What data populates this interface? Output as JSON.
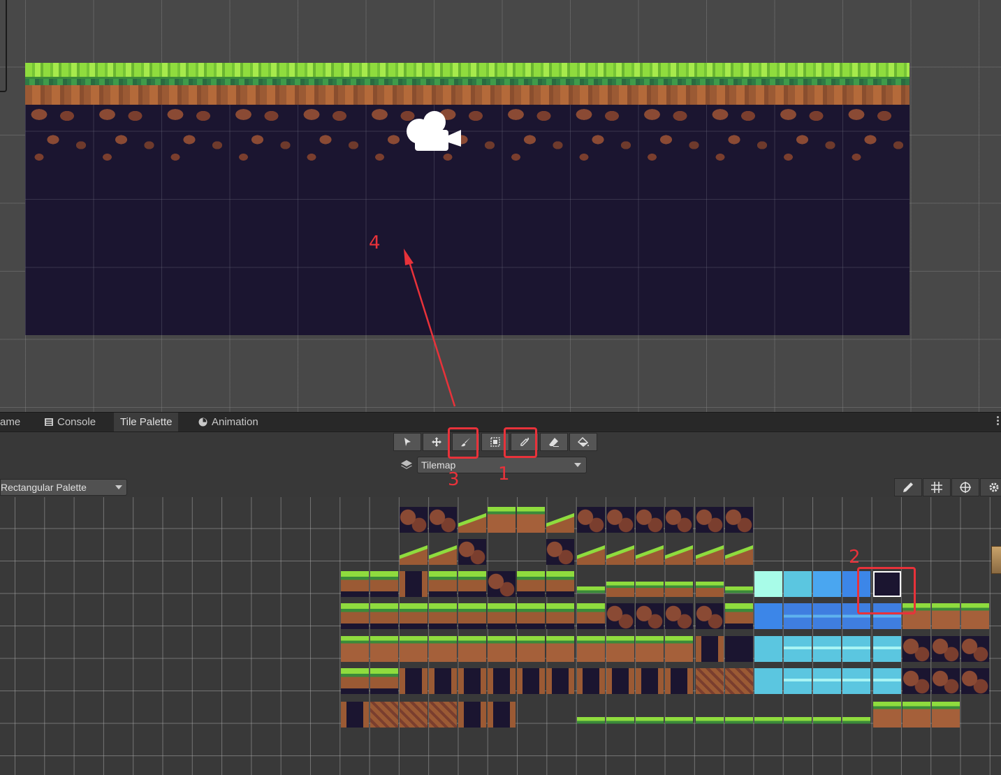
{
  "tabs": [
    {
      "label": "ame",
      "icon": "game-icon"
    },
    {
      "label": "Console",
      "icon": "console-icon"
    },
    {
      "label": "Tile Palette",
      "icon": ""
    },
    {
      "label": "Animation",
      "icon": "animation-clock-icon"
    }
  ],
  "active_tab": "Tile Palette",
  "toolbar": {
    "tools": [
      "select-tool",
      "move-tool",
      "paint-brush-tool",
      "box-fill-tool",
      "picker-tool",
      "eraser-tool",
      "flood-fill-tool"
    ],
    "highlighted": [
      "paint-brush-tool",
      "picker-tool"
    ]
  },
  "active_target": {
    "label": "Tilemap"
  },
  "palette": {
    "label": "Rectangular Palette"
  },
  "palette_tools": [
    "edit-pencil-icon",
    "grid-icon",
    "gizmo-icon",
    "settings-icon"
  ],
  "annotations": {
    "a1": "1",
    "a2": "2",
    "a3": "3",
    "a4": "4"
  },
  "colors": {
    "annotation": "#e8323a",
    "tile_background": "#1b1530",
    "grass": "#8fdc3e",
    "dirt": "#9b5a34"
  }
}
